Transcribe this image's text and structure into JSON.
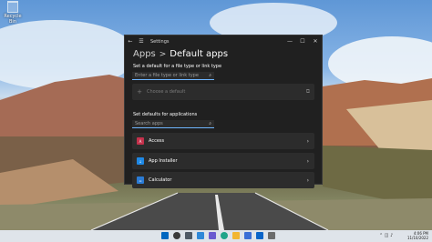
{
  "desktop": {
    "recycle_bin_label": "Recycle Bin",
    "icon": "recycle-bin-icon"
  },
  "window": {
    "title": "Settings",
    "back_icon": "back-arrow-icon",
    "menu_icon": "hamburger-menu-icon",
    "controls": {
      "minimize": "—",
      "maximize": "☐",
      "close": "✕"
    },
    "breadcrumb": {
      "parent": "Apps",
      "separator": ">",
      "current": "Default apps"
    },
    "filetype_section": {
      "label": "Set a default for a file type or link type",
      "placeholder": "Enter a file type or link type",
      "search_icon": "search-icon"
    },
    "choose_default": {
      "label": "Choose a default",
      "plus_icon": "plus-icon",
      "open_icon": "external-link-icon"
    },
    "applications_section": {
      "label": "Set defaults for applications",
      "search_placeholder": "Search apps",
      "search_icon": "search-icon"
    },
    "apps": [
      {
        "name": "Access",
        "icon": "access-icon",
        "color": "#c4314b"
      },
      {
        "name": "App Installer",
        "icon": "app-installer-icon",
        "color": "#1e88e5"
      },
      {
        "name": "Calculator",
        "icon": "calculator-icon",
        "color": "#2b7bd4"
      }
    ]
  },
  "taskbar": {
    "icons": [
      "windows-start-icon",
      "search-icon",
      "task-view-icon",
      "widgets-icon",
      "chat-icon",
      "edge-icon",
      "file-explorer-icon",
      "store-icon",
      "mail-icon",
      "settings-icon"
    ],
    "accent": "#0067c0",
    "time": "4:06 PM",
    "date": "11/10/2022"
  }
}
